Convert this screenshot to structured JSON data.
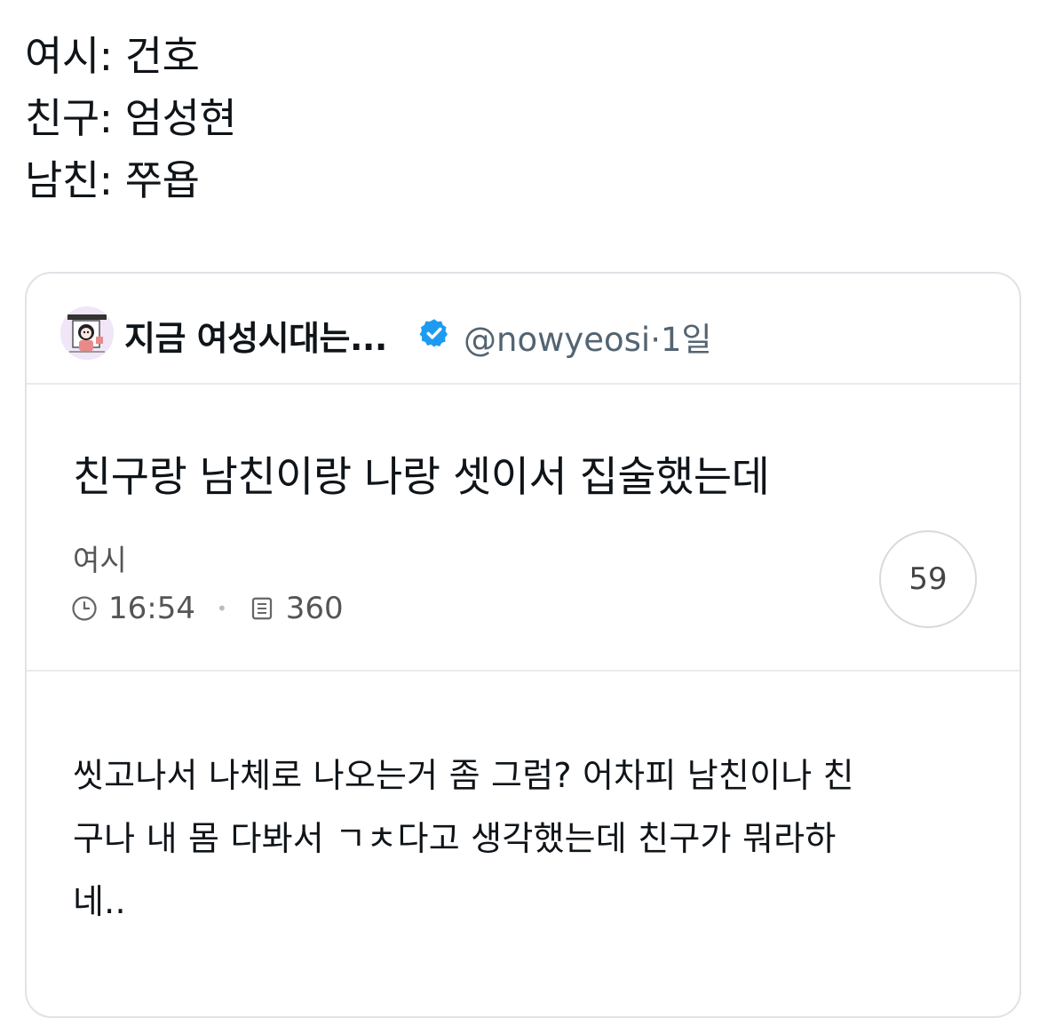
{
  "tweet": {
    "lines": [
      "여시: 건호",
      "친구: 엄성현",
      "남친: 쭈욥"
    ]
  },
  "quote": {
    "display_name": "지금 여성시대는...",
    "handle": "@nowyeosi",
    "separator": "·",
    "time_ago": "1일",
    "avatar_icon": "cartoon-avatar-icon",
    "verified_icon": "verified-badge-icon",
    "verified_color": "#1d9bf0",
    "post": {
      "title": "친구랑 남친이랑 나랑 셋이서 집술했는데",
      "author": "여시",
      "time": "16:54",
      "views": "360",
      "comments": "59",
      "body_lines": [
        "씻고나서 나체로 나오는거 좀 그럼? 어차피 남친이나 친",
        "구나 내 몸 다봐서 ㄱㅊ다고 생각했는데 친구가 뭐라하",
        "네.."
      ]
    }
  }
}
